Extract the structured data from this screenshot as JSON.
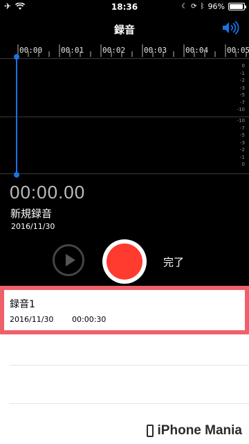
{
  "status_bar": {
    "time": "18:36",
    "battery": "96%",
    "battery_level": 0.96
  },
  "nav": {
    "title": "録音",
    "speaker_icon": "speaker-icon"
  },
  "timeline": {
    "ticks": [
      "00:00",
      "00:01",
      "00:02",
      "00:03",
      "00:04",
      "00:05"
    ],
    "db_top": [
      "0",
      "-1",
      "-2",
      "-3",
      "-5",
      "-7",
      "-10"
    ],
    "db_bottom": [
      "-10",
      "-7",
      "-5",
      "-3",
      "-2",
      "-1",
      "0"
    ]
  },
  "recording": {
    "elapsed": "00:00.00",
    "name": "新規録音",
    "date": "2016/11/30"
  },
  "controls": {
    "done_label": "完了"
  },
  "list": {
    "items": [
      {
        "title": "録音1",
        "date": "2016/11/30",
        "duration": "00:00:30"
      }
    ]
  },
  "watermark": {
    "brand": "iPhone Mania"
  },
  "colors": {
    "accent": "#1a73e8",
    "record": "#ff3b30",
    "highlight_border": "#f0606b"
  }
}
